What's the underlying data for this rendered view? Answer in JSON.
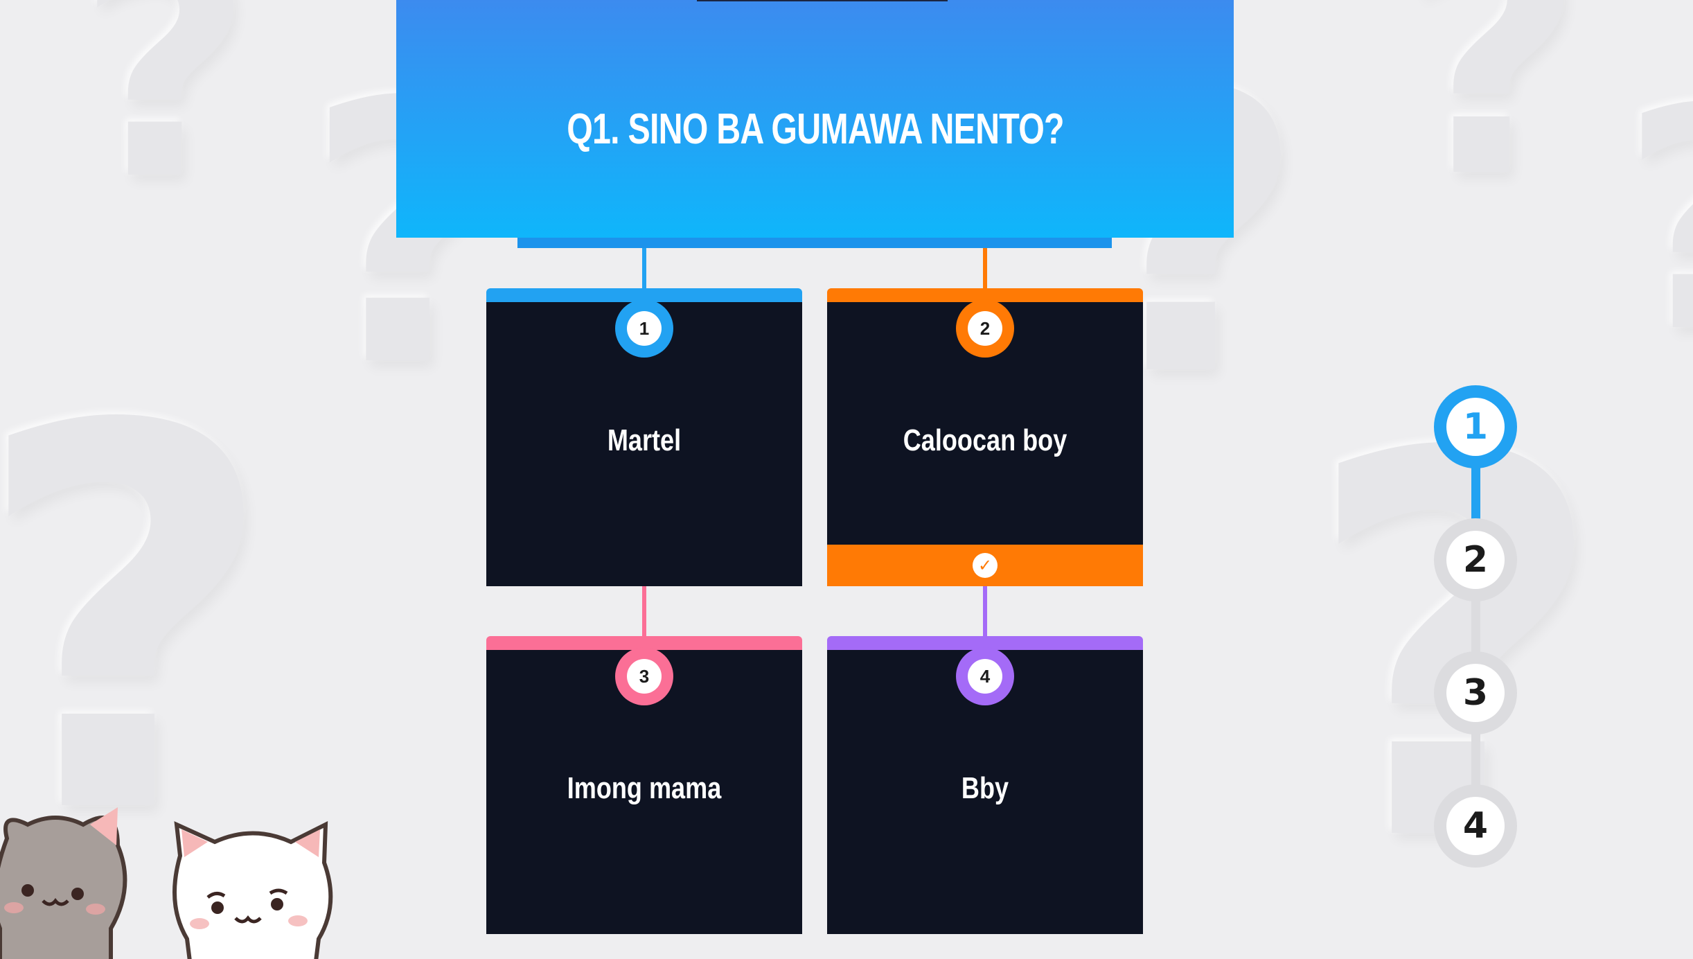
{
  "question": {
    "text": "Q1. SINO BA GUMAWA NENTO?"
  },
  "answers": [
    {
      "number": "1",
      "label": "Martel",
      "color": "#22a2f2",
      "correct": false
    },
    {
      "number": "2",
      "label": "Caloocan boy",
      "color": "#ff7a05",
      "correct": true
    },
    {
      "number": "3",
      "label": "Imong mama",
      "color": "#fb6f96",
      "correct": false
    },
    {
      "number": "4",
      "label": "Bby",
      "color": "#a46bf7",
      "correct": false
    }
  ],
  "progress": {
    "steps": [
      "1",
      "2",
      "3",
      "4"
    ],
    "current": "1",
    "accent_color": "#22a2f2",
    "inactive_color": "#dcdcdf"
  },
  "colors": {
    "background": "#eeeef0",
    "card_background": "#0e1322",
    "question_gradient_top": "#3c8bef",
    "question_gradient_bottom": "#0fb6fb",
    "correct_strip": "#ff7a05"
  },
  "icons": {
    "correct": "check-circle-icon",
    "decor": "cat-stickers"
  }
}
